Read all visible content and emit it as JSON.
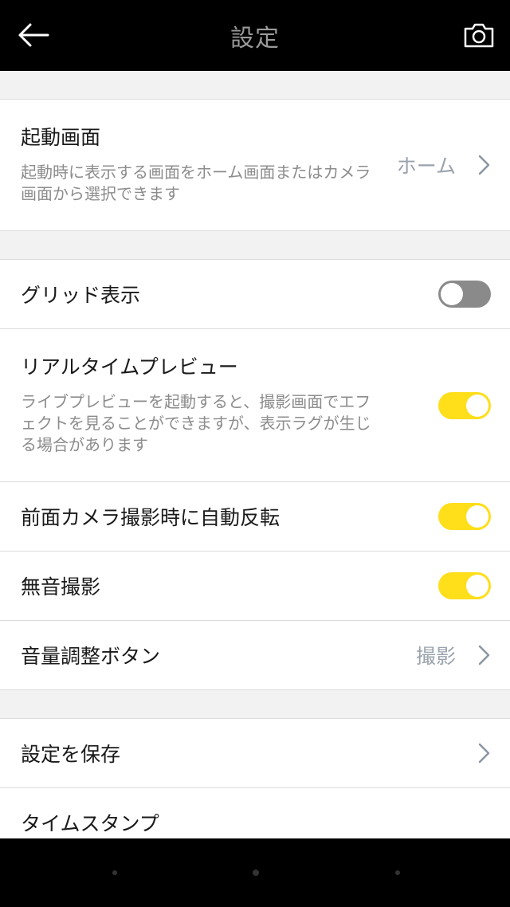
{
  "header": {
    "title": "設定",
    "back_icon": "arrow-left-icon",
    "camera_icon": "camera-icon"
  },
  "settings": {
    "startup_screen": {
      "title": "起動画面",
      "description": "起動時に表示する画面をホーム画面またはカメラ画面から選択できます",
      "value": "ホーム"
    },
    "grid_display": {
      "title": "グリッド表示",
      "enabled": false
    },
    "realtime_preview": {
      "title": "リアルタイムプレビュー",
      "description": "ライブプレビューを起動すると、撮影画面でエフェクトを見ることができますが、表示ラグが生じる場合があります",
      "enabled": true
    },
    "front_camera_mirror": {
      "title": "前面カメラ撮影時に自動反転",
      "enabled": true
    },
    "silent_shooting": {
      "title": "無音撮影",
      "enabled": true
    },
    "volume_button": {
      "title": "音量調整ボタン",
      "value": "撮影"
    },
    "save_settings": {
      "title": "設定を保存"
    },
    "timestamp": {
      "title": "タイムスタンプ"
    }
  },
  "colors": {
    "toggle_on": "#ffde1a",
    "toggle_off": "#8a8a8a",
    "value_text": "#9aa3ad",
    "bar_background": "#000000"
  }
}
